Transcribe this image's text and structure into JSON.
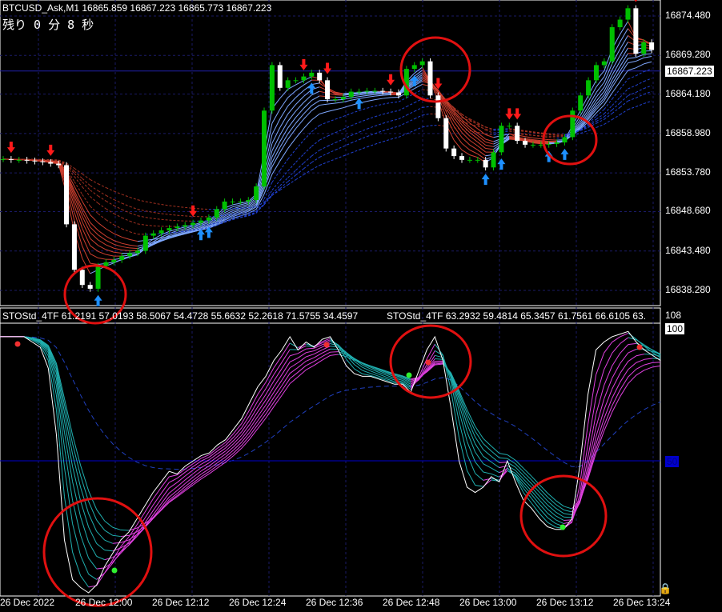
{
  "header": {
    "symbol_info": "BTCUSD_Ask,M1  16865.859 16867.223 16865.773 16867.223",
    "countdown": "残り 0 分 8 秒"
  },
  "indicator": {
    "label1": "STOStd_4TF 61.2191 57.0193 58.5067 54.4728 55.6632 52.2618 71.5755 34.4597",
    "label2": "STOStd_4TF 63.2932 59.4814 65.3457 61.7561 66.6105 63.",
    "levels": [
      "108",
      "100",
      "50"
    ]
  },
  "colors": {
    "bull": "#00c000",
    "bear": "#ffffff",
    "down_arrow": "#ff1a1a",
    "up_arrow": "#1e90ff",
    "circle": "#e01010",
    "grid": "#1a1a66"
  },
  "chart_data": [
    {
      "type": "candlestick",
      "title": "BTCUSD_Ask,M1",
      "price_ticks": [
        "16874.480",
        "16869.280",
        "16864.180",
        "16858.980",
        "16853.780",
        "16848.680",
        "16843.480",
        "16838.280"
      ],
      "current_price": "16867.223",
      "ylim": [
        16836.9,
        16876.6
      ],
      "x_labels": [
        "26 Dec 2022",
        "26 Dec 12:00",
        "26 Dec 12:12",
        "26 Dec 12:24",
        "26 Dec 12:36",
        "26 Dec 12:48",
        "26 Dec 13:00",
        "26 Dec 13:12",
        "26 Dec 13:24"
      ],
      "closes": [
        16855.6,
        16855.5,
        16855.5,
        16855.4,
        16855.3,
        16855.2,
        16855,
        16854.8,
        16847,
        16841,
        16839,
        16838.5,
        16841.5,
        16842,
        16842.3,
        16842.8,
        16843.2,
        16843.5,
        16845.5,
        16845.8,
        16846.2,
        16846.5,
        16846.7,
        16846.9,
        16847.2,
        16847.5,
        16847.9,
        16849,
        16850,
        16850,
        16850,
        16850.2,
        16852,
        16862,
        16868,
        16865,
        16866,
        16866,
        16866.5,
        16867,
        16866,
        16863.5,
        16863.5,
        16863.8,
        16864.5,
        16864.5,
        16864.6,
        16864.6,
        16864.5,
        16864.4,
        16864,
        16867.5,
        16868,
        16868.5,
        16864,
        16861,
        16857,
        16856,
        16855.5,
        16855.5,
        16855.5,
        16854.5,
        16856.5,
        16860,
        16860,
        16858,
        16857.5,
        16857.5,
        16857.5,
        16857.6,
        16857.8,
        16858.5,
        16862,
        16864,
        16866,
        16868,
        16868.5,
        16873,
        16874,
        16875.5,
        16869.5,
        16871,
        16870
      ],
      "sell_arrows_at": [
        1,
        6,
        24,
        38,
        41,
        49,
        55,
        64,
        65,
        80
      ],
      "buy_arrows_at": [
        12,
        25,
        26,
        39,
        45,
        52,
        61,
        63,
        69,
        71
      ]
    },
    {
      "type": "line",
      "title": "STOStd_4TF",
      "ylim": [
        0,
        100
      ],
      "levels": [
        50
      ],
      "values": [
        97,
        97,
        97,
        97,
        95,
        93,
        85,
        60,
        20,
        5,
        2,
        0,
        3,
        10,
        15,
        20,
        23,
        28,
        33,
        38,
        42,
        46,
        45,
        48,
        50,
        52,
        53,
        56,
        58,
        62,
        66,
        72,
        78,
        82,
        88,
        92,
        97,
        92,
        95,
        93,
        96,
        97,
        92,
        86,
        83,
        82,
        82,
        81,
        80,
        79,
        79,
        76,
        84,
        92,
        97,
        88,
        70,
        50,
        40,
        38,
        40,
        44,
        42,
        50,
        42,
        35,
        32,
        28,
        25,
        24,
        24,
        28,
        48,
        75,
        92,
        95,
        97,
        98,
        99,
        95,
        92,
        90,
        88
      ]
    }
  ]
}
